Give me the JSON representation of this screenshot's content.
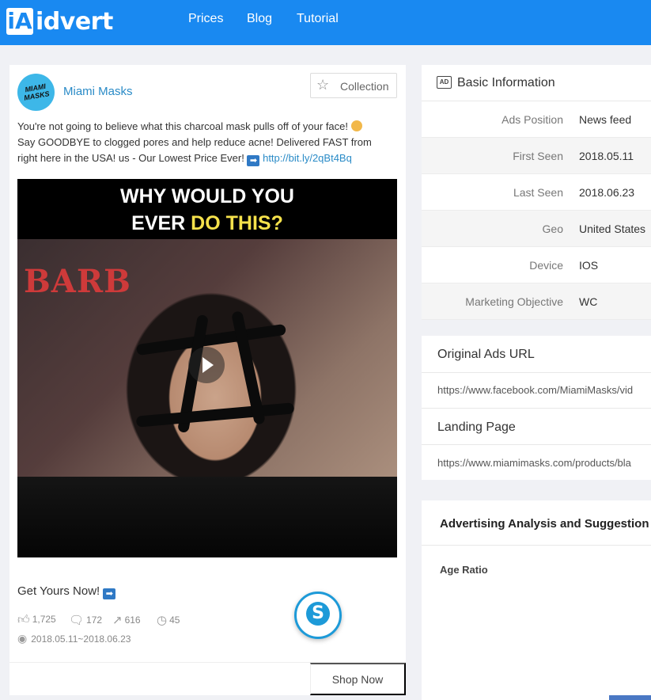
{
  "header": {
    "logo_mark": "iA",
    "logo_text": "idvert",
    "nav": [
      "Prices",
      "Blog",
      "Tutorial"
    ],
    "bg_color": "#1989f1"
  },
  "ad": {
    "avatar_text": "MIAMI MASKS",
    "advertiser": "Miami Masks",
    "collection_icon": "star-icon",
    "collection_label": "Collection",
    "text_line1": "You're not going to believe what this charcoal mask pulls off of your face!",
    "text_line2": "Say GOODBYE to clogged pores and help reduce acne! Delivered FAST from",
    "text_line3": "right here in the USA! us - Our Lowest Price Ever!",
    "link": "http://bit.ly/2qBt4Bq",
    "caption_line1": "WHY WOULD YOU",
    "caption_line2a": "EVER ",
    "caption_line2b": "DO THIS?",
    "sign_text": "BARB",
    "cta_text": "Get Yours Now!",
    "likes": "1,725",
    "comments": "172",
    "shares": "616",
    "views": "45",
    "date_range": "2018.05.11~2018.06.23",
    "shop_label": "Shop Now"
  },
  "basic_info": {
    "title": "Basic Information",
    "rows": [
      {
        "k": "Ads Position",
        "v": "News feed"
      },
      {
        "k": "First Seen",
        "v": "2018.05.11"
      },
      {
        "k": "Last Seen",
        "v": "2018.06.23"
      },
      {
        "k": "Geo",
        "v": "United States"
      },
      {
        "k": "Device",
        "v": "IOS"
      },
      {
        "k": "Marketing Objective",
        "v": "WC"
      }
    ]
  },
  "urls": {
    "original_title": "Original Ads URL",
    "original_url": "https://www.facebook.com/MiamiMasks/vid",
    "landing_title": "Landing Page",
    "landing_url": "https://www.miamimasks.com/products/bla"
  },
  "analysis": {
    "title": "Advertising Analysis and Suggestion",
    "age_ratio": "Age Ratio"
  }
}
